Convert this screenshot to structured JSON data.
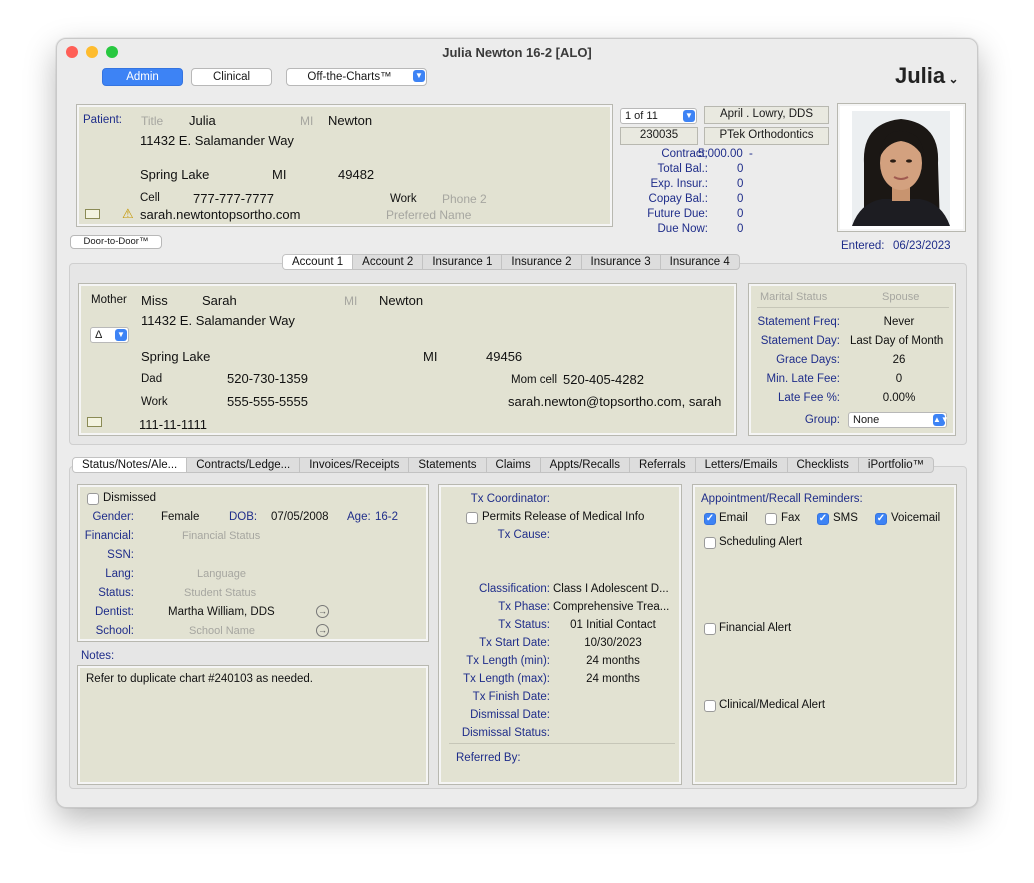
{
  "window": {
    "title": "Julia Newton 16-2 [ALO]",
    "user_menu": "Julia"
  },
  "toolbar": {
    "admin": "Admin",
    "clinical": "Clinical",
    "off_the_charts": "Off-the-Charts™"
  },
  "patient": {
    "label": "Patient:",
    "title_placeholder": "Title",
    "first": "Julia",
    "mi_placeholder": "MI",
    "last": "Newton",
    "address": "11432 E. Salamander Way",
    "city": "Spring Lake",
    "state": "MI",
    "zip": "49482",
    "cell_label": "Cell",
    "cell": "777-777-7777",
    "work_label": "Work",
    "phone2_placeholder": "Phone 2",
    "email": "sarah.newtontopsortho.com",
    "preferred_placeholder": "Preferred Name"
  },
  "door_button": "Door-to-Door™",
  "record": {
    "position": "1 of 11",
    "doctor": "April . Lowry, DDS",
    "chart_no": "230035",
    "practice": "PTek Orthodontics"
  },
  "balances": {
    "contract_label": "Contract:",
    "contract": "5,000.00",
    "contract_suffix": "-",
    "total_label": "Total Bal.:",
    "total": "0",
    "exp_label": "Exp. Insur.:",
    "exp": "0",
    "copay_label": "Copay Bal.:",
    "copay": "0",
    "future_label": "Future Due:",
    "future": "0",
    "due_label": "Due Now:",
    "due": "0"
  },
  "entered": {
    "label": "Entered:",
    "date": "06/23/2023"
  },
  "account_tabs": [
    "Account 1",
    "Account 2",
    "Insurance 1",
    "Insurance 2",
    "Insurance 3",
    "Insurance 4"
  ],
  "responsible": {
    "relation": "Mother",
    "title": "Miss",
    "first": "Sarah",
    "mi_placeholder": "MI",
    "last": "Newton",
    "address": "11432 E. Salamander Way",
    "delta": "Δ",
    "city": "Spring Lake",
    "state": "MI",
    "zip": "49456",
    "dad_label": "Dad",
    "dad_phone": "520-730-1359",
    "mom_cell_label": "Mom cell",
    "mom_cell": "520-405-4282",
    "work_label": "Work",
    "work_phone": "555-555-5555",
    "email": "sarah.newton@topsortho.com, sarah",
    "ssn": "111-11-1111"
  },
  "account_settings": {
    "marital_placeholder": "Marital Status",
    "spouse_placeholder": "Spouse",
    "stmt_freq_label": "Statement Freq:",
    "stmt_freq": "Never",
    "stmt_day_label": "Statement Day:",
    "stmt_day": "Last Day of Month",
    "grace_label": "Grace Days:",
    "grace": "26",
    "min_late_label": "Min. Late Fee:",
    "min_late": "0",
    "late_pct_label": "Late Fee %:",
    "late_pct": "0.00%",
    "group_label": "Group:",
    "group": "None"
  },
  "lower_tabs": [
    "Status/Notes/Ale...",
    "Contracts/Ledge...",
    "Invoices/Receipts",
    "Statements",
    "Claims",
    "Appts/Recalls",
    "Referrals",
    "Letters/Emails",
    "Checklists",
    "iPortfolio™"
  ],
  "status": {
    "dismissed": "Dismissed",
    "gender_label": "Gender:",
    "gender": "Female",
    "dob_label": "DOB:",
    "dob": "07/05/2008",
    "age_label": "Age:",
    "age": "16-2",
    "financial_label": "Financial:",
    "financial_placeholder": "Financial Status",
    "ssn_label": "SSN:",
    "lang_label": "Lang:",
    "lang_placeholder": "Language",
    "status_label": "Status:",
    "status_placeholder": "Student Status",
    "dentist_label": "Dentist:",
    "dentist": "Martha William, DDS",
    "school_label": "School:",
    "school_placeholder": "School Name"
  },
  "notes": {
    "label": "Notes:",
    "text": "Refer to duplicate chart #240103 as needed."
  },
  "treatment": {
    "coordinator_label": "Tx Coordinator:",
    "permits": "Permits Release of Medical Info",
    "cause_label": "Tx Cause:",
    "class_label": "Classification:",
    "class": "Class I Adolescent D...",
    "phase_label": "Tx Phase:",
    "phase": "Comprehensive Trea...",
    "status_label": "Tx Status:",
    "status": "01 Initial Contact",
    "start_label": "Tx Start Date:",
    "start": "10/30/2023",
    "lmin_label": "Tx Length (min):",
    "lmin": "24 months",
    "lmax_label": "Tx Length (max):",
    "lmax": "24 months",
    "finish_label": "Tx Finish Date:",
    "dismissal_date_label": "Dismissal Date:",
    "dismissal_status_label": "Dismissal Status:",
    "referred_label": "Referred By:"
  },
  "reminders": {
    "title": "Appointment/Recall Reminders:",
    "email": "Email",
    "fax": "Fax",
    "sms": "SMS",
    "voicemail": "Voicemail",
    "scheduling": "Scheduling Alert",
    "financial": "Financial Alert",
    "clinical": "Clinical/Medical Alert"
  },
  "colors": {
    "accent": "#3d83f5",
    "label": "#1f2d8a",
    "panel": "#e2e2d2"
  }
}
